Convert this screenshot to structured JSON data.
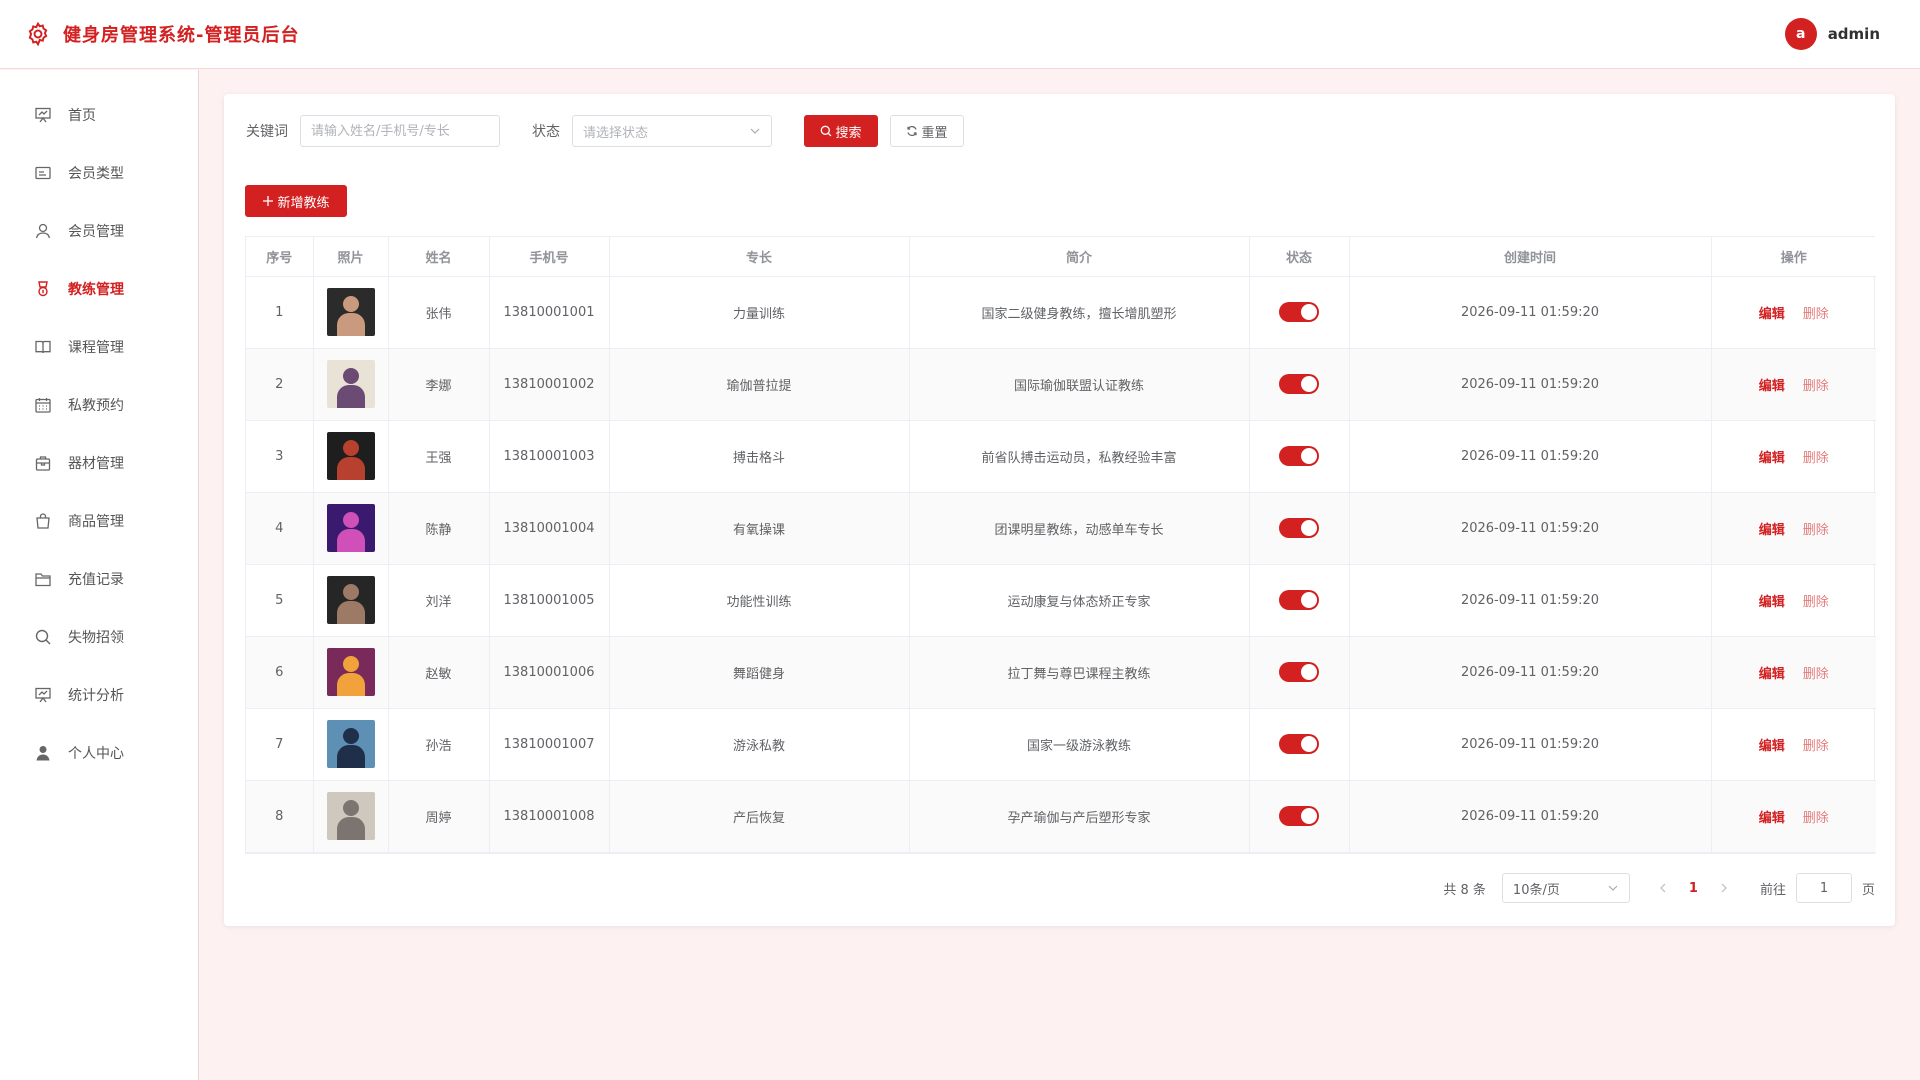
{
  "header": {
    "title": "健身房管理系统-管理员后台",
    "avatar_letter": "a",
    "username": "admin"
  },
  "sidebar": {
    "items": [
      {
        "label": "首页",
        "icon": "dashboard-icon"
      },
      {
        "label": "会员类型",
        "icon": "card-icon"
      },
      {
        "label": "会员管理",
        "icon": "user-icon"
      },
      {
        "label": "教练管理",
        "icon": "medal-icon",
        "active": true
      },
      {
        "label": "课程管理",
        "icon": "book-icon"
      },
      {
        "label": "私教预约",
        "icon": "calendar-icon"
      },
      {
        "label": "器材管理",
        "icon": "box-icon"
      },
      {
        "label": "商品管理",
        "icon": "bag-icon"
      },
      {
        "label": "充值记录",
        "icon": "folder-icon"
      },
      {
        "label": "失物招领",
        "icon": "search-icon"
      },
      {
        "label": "统计分析",
        "icon": "chart-icon"
      },
      {
        "label": "个人中心",
        "icon": "person-icon"
      }
    ]
  },
  "filters": {
    "keyword_label": "关键词",
    "keyword_placeholder": "请输入姓名/手机号/专长",
    "status_label": "状态",
    "status_placeholder": "请选择状态",
    "search_label": "搜索",
    "reset_label": "重置"
  },
  "add_button_label": "新增教练",
  "table": {
    "columns": [
      "序号",
      "照片",
      "姓名",
      "手机号",
      "专长",
      "简介",
      "状态",
      "创建时间",
      "操作"
    ],
    "edit_label": "编辑",
    "delete_label": "删除",
    "rows": [
      {
        "no": "1",
        "name": "张伟",
        "phone": "13810001001",
        "specialty": "力量训练",
        "intro": "国家二级健身教练，擅长增肌塑形",
        "status_on": true,
        "created": "2026-09-11 01:59:20",
        "photo_bg": "#2b2b2b",
        "photo_fg": "#c99a7d"
      },
      {
        "no": "2",
        "name": "李娜",
        "phone": "13810001002",
        "specialty": "瑜伽普拉提",
        "intro": "国际瑜伽联盟认证教练",
        "status_on": true,
        "created": "2026-09-11 01:59:20",
        "photo_bg": "#e9e2d6",
        "photo_fg": "#6b4a73"
      },
      {
        "no": "3",
        "name": "王强",
        "phone": "13810001003",
        "specialty": "搏击格斗",
        "intro": "前省队搏击运动员，私教经验丰富",
        "status_on": true,
        "created": "2026-09-11 01:59:20",
        "photo_bg": "#1e1e1e",
        "photo_fg": "#b8402f"
      },
      {
        "no": "4",
        "name": "陈静",
        "phone": "13810001004",
        "specialty": "有氧操课",
        "intro": "团课明星教练，动感单车专长",
        "status_on": true,
        "created": "2026-09-11 01:59:20",
        "photo_bg": "#3a1a6e",
        "photo_fg": "#d04fb8"
      },
      {
        "no": "5",
        "name": "刘洋",
        "phone": "13810001005",
        "specialty": "功能性训练",
        "intro": "运动康复与体态矫正专家",
        "status_on": true,
        "created": "2026-09-11 01:59:20",
        "photo_bg": "#262626",
        "photo_fg": "#9c7a66"
      },
      {
        "no": "6",
        "name": "赵敏",
        "phone": "13810001006",
        "specialty": "舞蹈健身",
        "intro": "拉丁舞与尊巴课程主教练",
        "status_on": true,
        "created": "2026-09-11 01:59:20",
        "photo_bg": "#7a2a5a",
        "photo_fg": "#f2a23a"
      },
      {
        "no": "7",
        "name": "孙浩",
        "phone": "13810001007",
        "specialty": "游泳私教",
        "intro": "国家一级游泳教练",
        "status_on": true,
        "created": "2026-09-11 01:59:20",
        "photo_bg": "#5e8fb5",
        "photo_fg": "#1f2f4a"
      },
      {
        "no": "8",
        "name": "周婷",
        "phone": "13810001008",
        "specialty": "产后恢复",
        "intro": "孕产瑜伽与产后塑形专家",
        "status_on": true,
        "created": "2026-09-11 01:59:20",
        "photo_bg": "#cfc8bf",
        "photo_fg": "#7b7470"
      }
    ]
  },
  "pagination": {
    "total_text": "共 8 条",
    "page_size": "10条/页",
    "current_page": "1",
    "goto_label": "前往",
    "goto_value": "1",
    "page_suffix": "页"
  },
  "colors": {
    "accent": "#d32020",
    "background": "#fdf1f1"
  }
}
